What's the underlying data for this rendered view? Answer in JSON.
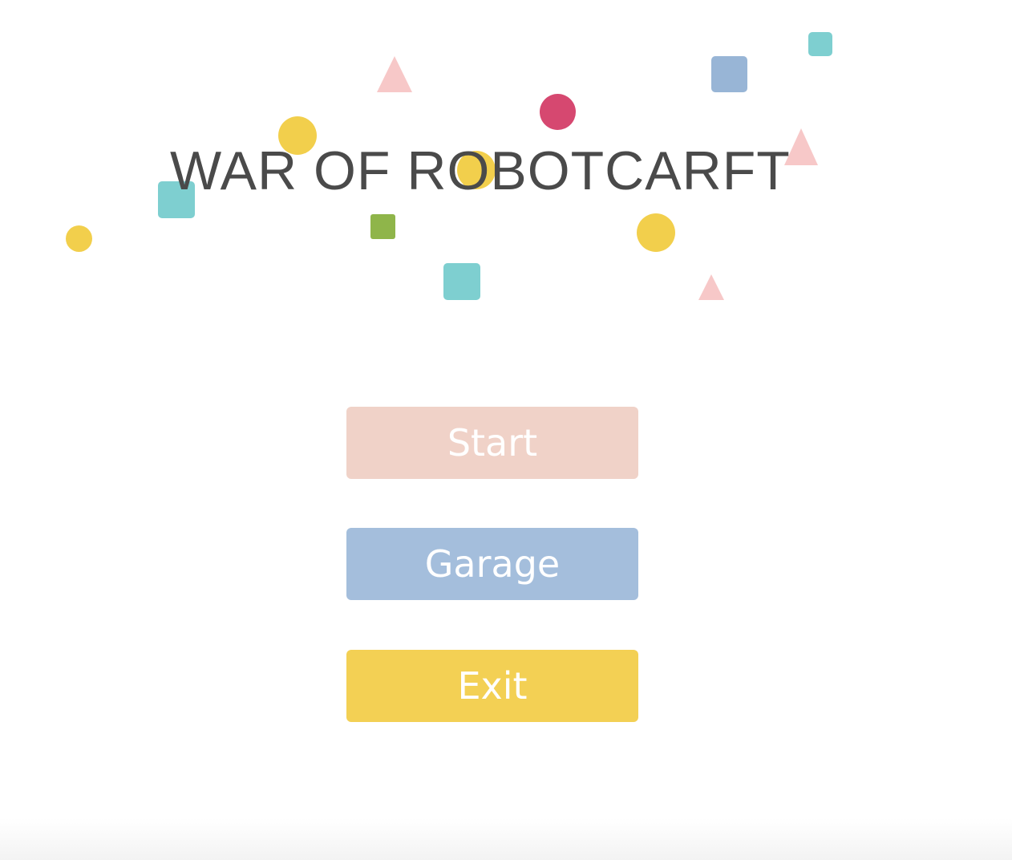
{
  "title": "WAR OF ROBOTCARFT",
  "menu": {
    "start_label": "Start",
    "garage_label": "Garage",
    "exit_label": "Exit"
  },
  "colors": {
    "background": "#ffffff",
    "title_text": "#4a4a4a",
    "start_button": "#f0d2c8",
    "garage_button": "#a4bedc",
    "exit_button": "#f3d054",
    "confetti_yellow": "#f2cf4c",
    "confetti_teal": "#7ecfd0",
    "confetti_pink": "#f7c8c8",
    "confetti_blue": "#98b5d6",
    "confetti_crimson": "#d64870",
    "confetti_green": "#8fb54a"
  }
}
